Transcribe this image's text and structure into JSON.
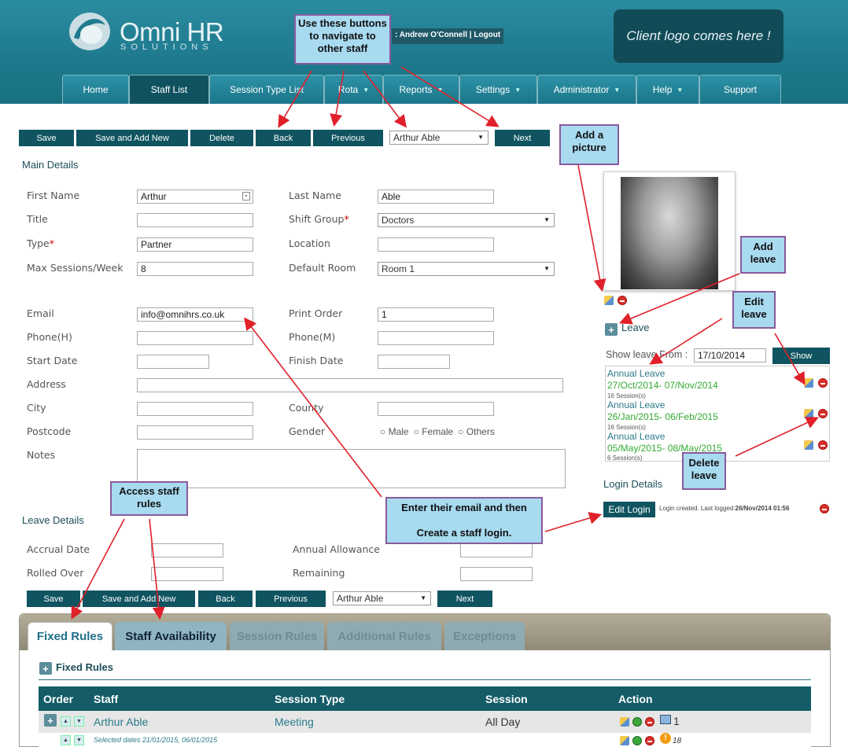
{
  "header": {
    "logo_title": "Omni HR",
    "logo_subtitle": "SOLUTIONS",
    "user_info": ": Andrew O'Connell | Logout",
    "client_logo": "Client logo comes here !"
  },
  "nav": {
    "items": [
      {
        "label": "Home"
      },
      {
        "label": "Staff List"
      },
      {
        "label": "Session Type List"
      },
      {
        "label": "Rota"
      },
      {
        "label": "Reports"
      },
      {
        "label": "Settings"
      },
      {
        "label": "Administrator"
      },
      {
        "label": "Help"
      },
      {
        "label": "Support"
      }
    ]
  },
  "toolbar": {
    "save": "Save",
    "save_add_new": "Save and Add New",
    "delete": "Delete",
    "back": "Back",
    "previous": "Previous",
    "staff_select": "Arthur Able",
    "next": "Next"
  },
  "main_details": {
    "title": "Main Details",
    "first_name_label": "First Name",
    "first_name_value": "Arthur",
    "last_name_label": "Last Name",
    "last_name_value": "Able",
    "title_label": "Title",
    "title_value": "",
    "shift_group_label": "Shift Group",
    "shift_group_value": "Doctors",
    "type_label": "Type",
    "type_value": "Partner",
    "location_label": "Location",
    "location_value": "",
    "max_sessions_label": "Max Sessions/Week",
    "max_sessions_value": "8",
    "default_room_label": "Default Room",
    "default_room_value": "Room 1",
    "email_label": "Email",
    "email_value": "info@omnihrs.co.uk",
    "print_order_label": "Print Order",
    "print_order_value": "1",
    "phone_h_label": "Phone(H)",
    "phone_m_label": "Phone(M)",
    "start_date_label": "Start Date",
    "finish_date_label": "Finish Date",
    "address_label": "Address",
    "city_label": "City",
    "county_label": "County",
    "postcode_label": "Postcode",
    "gender_label": "Gender",
    "gender_options": [
      "Male",
      "Female",
      "Others"
    ],
    "notes_label": "Notes"
  },
  "leave_details": {
    "title": "Leave Details",
    "accrual_date_label": "Accrual Date",
    "annual_allowance_label": "Annual Allowance",
    "rolled_over_label": "Rolled Over",
    "remaining_label": "Remaining"
  },
  "right_panel": {
    "leave_header": "Leave",
    "show_leave_from_label": "Show leave From :",
    "show_leave_from_value": "17/10/2014",
    "show_button": "Show",
    "leaves": [
      {
        "type": "Annual Leave",
        "dates": "27/Oct/2014- 07/Nov/2014",
        "sessions": "16 Session(s)"
      },
      {
        "type": "Annual Leave",
        "dates": "26/Jan/2015- 06/Feb/2015",
        "sessions": "16 Session(s)"
      },
      {
        "type": "Annual Leave",
        "dates": "05/May/2015- 08/May/2015",
        "sessions": "6 Session(s)"
      }
    ],
    "login_details_title": "Login Details",
    "edit_login_button": "Edit Login",
    "login_status": "Login created. Last logged:",
    "login_last": "26/Nov/2014 01:56"
  },
  "callouts": {
    "navigate": "Use these buttons to navigate to other staff",
    "add_picture": "Add a picture",
    "add_leave": "Add leave",
    "edit_leave": "Edit leave",
    "delete_leave": "Delete leave",
    "email_login_line1": "Enter their email and then",
    "email_login_line2": "Create a staff login.",
    "access_rules": "Access staff rules"
  },
  "tabs": [
    {
      "label": "Fixed Rules"
    },
    {
      "label": "Staff Availability"
    },
    {
      "label": "Session Rules"
    },
    {
      "label": "Additional Rules"
    },
    {
      "label": "Exceptions"
    }
  ],
  "fixed_rules": {
    "header": "Fixed Rules",
    "columns": [
      "Order",
      "Staff",
      "Session Type",
      "Session",
      "Action"
    ],
    "row1": {
      "staff": "Arthur Able",
      "session_type": "Meeting",
      "session": "All Day",
      "count": "1"
    },
    "row2": {
      "note": "Selected dates 21/01/2015, 06/01/2015",
      "count": "18"
    }
  },
  "colors": {
    "header_teal": "#1f7a8e",
    "button_dark": "#0f5460",
    "callout_fill": "#a8daf0",
    "callout_border": "#8a5a9c",
    "arrow_red": "#e0202a",
    "leave_green": "#33aa33"
  }
}
